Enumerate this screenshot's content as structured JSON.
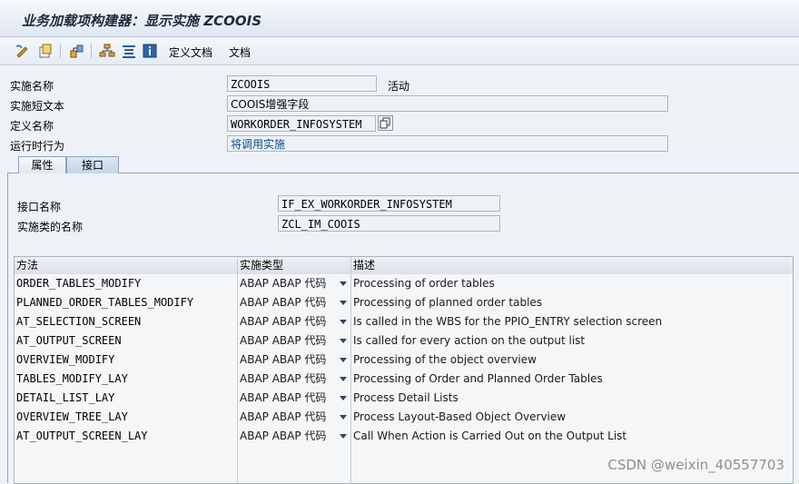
{
  "window": {
    "title": "业务加载项构建器：显示实施 ZCOOIS"
  },
  "toolbar": {
    "items": [
      {
        "icon": "display-change-icon"
      },
      {
        "icon": "other-object-icon"
      },
      {
        "icon": "where-used-icon"
      },
      {
        "icon": "hierarchy-icon"
      },
      {
        "icon": "list-icon"
      },
      {
        "icon": "info-icon"
      }
    ],
    "define_doc_label": "定义文档",
    "doc_label": "文档"
  },
  "header": {
    "impl_name_label": "实施名称",
    "impl_name_value": "ZCOOIS",
    "status": "活动",
    "short_text_label": "实施短文本",
    "short_text_value": "COOIS增强字段",
    "definition_label": "定义名称",
    "definition_value": "WORKORDER_INFOSYSTEM",
    "runtime_label": "运行时行为",
    "runtime_value": "将调用实施"
  },
  "tabs": [
    {
      "label": "属性",
      "active": false
    },
    {
      "label": "接口",
      "active": true
    }
  ],
  "interface": {
    "name_label": "接口名称",
    "name_value": "IF_EX_WORKORDER_INFOSYSTEM",
    "class_label": "实施类的名称",
    "class_value": "ZCL_IM_COOIS"
  },
  "methods_table": {
    "columns": [
      "方法",
      "实施类型",
      "描述"
    ],
    "rows": [
      {
        "method": "ORDER_TABLES_MODIFY",
        "type": "ABAP ABAP 代码",
        "desc": "Processing of order tables"
      },
      {
        "method": "PLANNED_ORDER_TABLES_MODIFY",
        "type": "ABAP ABAP 代码",
        "desc": "Processing of planned order tables"
      },
      {
        "method": "AT_SELECTION_SCREEN",
        "type": "ABAP ABAP 代码",
        "desc": "Is called in the WBS for the PPIO_ENTRY selection screen"
      },
      {
        "method": "AT_OUTPUT_SCREEN",
        "type": "ABAP ABAP 代码",
        "desc": "Is called for every action on the output list"
      },
      {
        "method": "OVERVIEW_MODIFY",
        "type": "ABAP ABAP 代码",
        "desc": "Processing of the object overview"
      },
      {
        "method": "TABLES_MODIFY_LAY",
        "type": "ABAP ABAP 代码",
        "desc": "Processing of Order and Planned Order Tables"
      },
      {
        "method": "DETAIL_LIST_LAY",
        "type": "ABAP ABAP 代码",
        "desc": "Process Detail Lists"
      },
      {
        "method": "OVERVIEW_TREE_LAY",
        "type": "ABAP ABAP 代码",
        "desc": "Process Layout-Based Object Overview"
      },
      {
        "method": "AT_OUTPUT_SCREEN_LAY",
        "type": "ABAP ABAP 代码",
        "desc": "Call When Action is Carried Out on the Output List"
      }
    ]
  },
  "watermark": "CSDN @weixin_40557703"
}
